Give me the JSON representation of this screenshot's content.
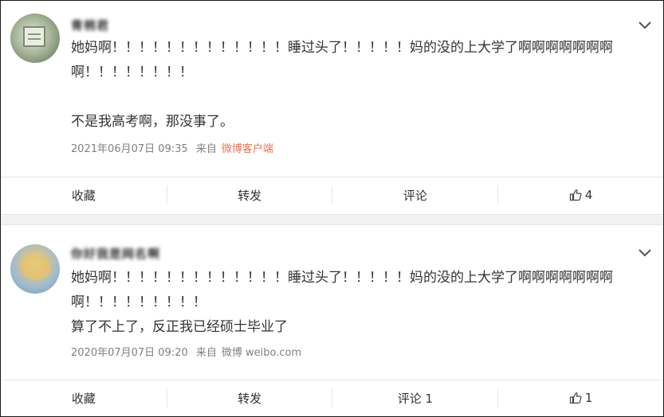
{
  "posts": [
    {
      "user_name": "青梢君",
      "text": "她妈啊！！！！！！！！！！！！！睡过头了！！！！！妈的没的上大学了啊啊啊啊啊啊啊啊！！！！！！！！\n\n不是我高考啊，那没事了。",
      "time": "2021年06月07日 09:35",
      "from_label": "来自",
      "source": "微博客户端",
      "source_color": "#eb7350",
      "actions": {
        "favorite": "收藏",
        "repost": "转发",
        "comment": "评论",
        "like_count": "4"
      }
    },
    {
      "user_name": "你好我是网名啊",
      "text": "她妈啊！！！！！！！！！！！！！睡过头了！！！！！妈的没的上大学了啊啊啊啊啊啊啊啊！！！！！！！！！\n算了不上了，反正我已经硕士毕业了",
      "time": "2020年07月07日 09:20",
      "from_label": "来自",
      "source": "微博 weibo.com",
      "source_color": "#808080",
      "actions": {
        "favorite": "收藏",
        "repost": "转发",
        "comment": "评论 1",
        "like_count": "1"
      }
    }
  ],
  "icons": {
    "menu": "chevron-down-icon",
    "like": "thumbs-up-icon"
  }
}
